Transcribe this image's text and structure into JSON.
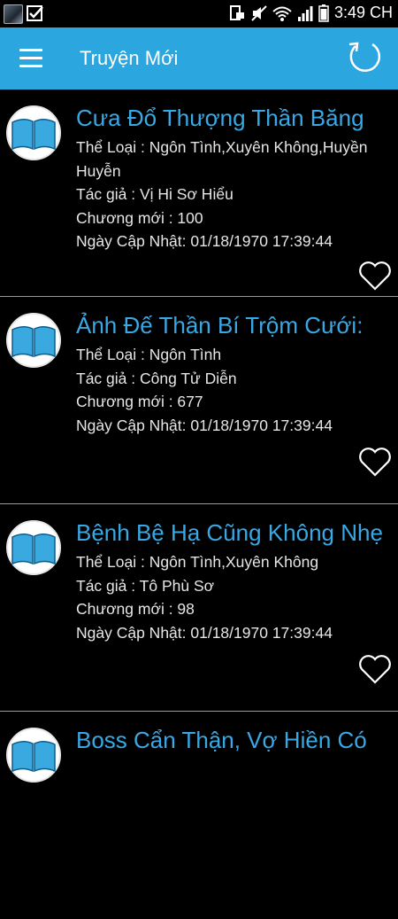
{
  "status_bar": {
    "time": "3:49 CH"
  },
  "toolbar": {
    "title": "Truyện Mới",
    "menu_icon": "hamburger-menu-icon",
    "refresh_icon": "refresh-icon",
    "background": "#2ba6df"
  },
  "labels": {
    "genre": "Thể Loại : ",
    "author": "Tác giả : ",
    "chapter": "Chương mới : ",
    "updated": "Ngày Cập Nhật: "
  },
  "stories": [
    {
      "title": "Cưa Đổ Thượng Thần Băng",
      "genre": "Ngôn Tình,Xuyên Không,Huyền Huyễn",
      "author": "Vị Hi Sơ Hiểu",
      "chapter": "100",
      "updated": "01/18/1970 17:39:44"
    },
    {
      "title": "Ảnh Đế Thần Bí Trộm Cưới:",
      "genre": "Ngôn Tình",
      "author": "Công Tử Diễn",
      "chapter": "677",
      "updated": "01/18/1970 17:39:44"
    },
    {
      "title": "Bệnh Bệ Hạ Cũng Không Nhẹ",
      "genre": "Ngôn Tình,Xuyên Không",
      "author": "Tô Phù Sơ",
      "chapter": "98",
      "updated": "01/18/1970 17:39:44"
    },
    {
      "title": "Boss Cẩn Thận, Vợ Hiền Có",
      "genre": "",
      "author": "",
      "chapter": "",
      "updated": ""
    }
  ],
  "colors": {
    "title_text": "#38a9e6",
    "meta_text": "#e6e6e6",
    "divider": "#9a9a9a"
  }
}
